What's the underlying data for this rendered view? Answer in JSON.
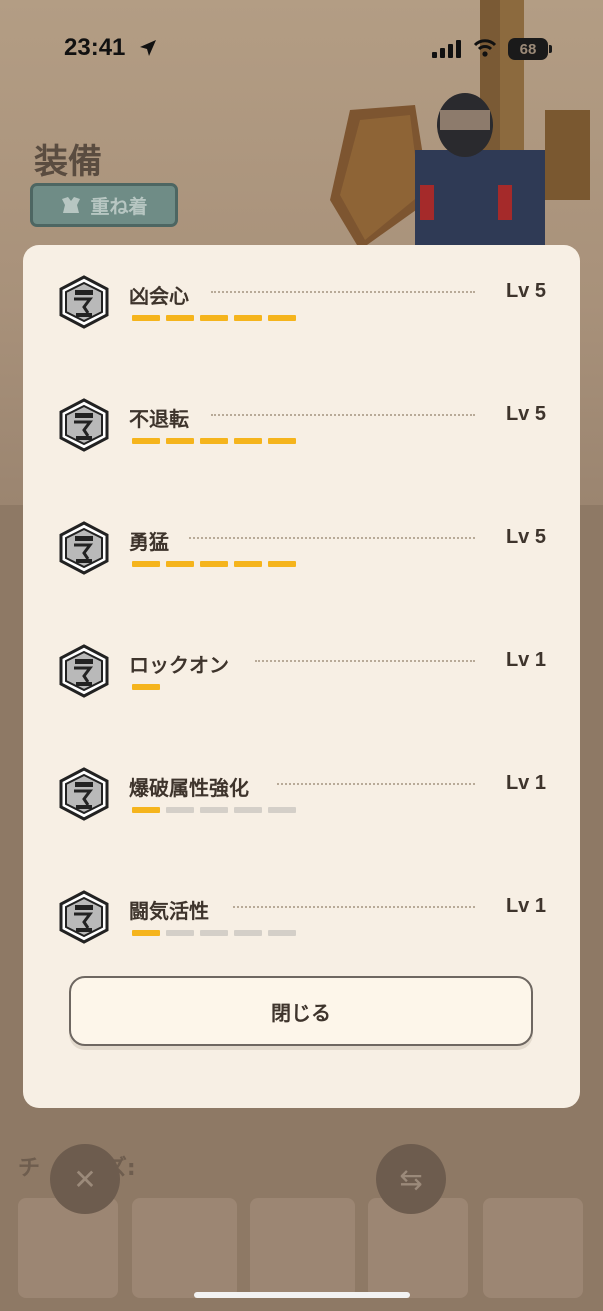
{
  "status_bar": {
    "time": "23:41",
    "battery": "68"
  },
  "background": {
    "page_title": "装備",
    "layer_button_label": "重ね着",
    "section_label": "チ　リーズ:"
  },
  "modal": {
    "skills": [
      {
        "name": "凶会心",
        "level_label": "Lv 5",
        "level": 5,
        "max_level": 5
      },
      {
        "name": "不退転",
        "level_label": "Lv 5",
        "level": 5,
        "max_level": 5
      },
      {
        "name": "勇猛",
        "level_label": "Lv 5",
        "level": 5,
        "max_level": 5
      },
      {
        "name": "ロックオン",
        "level_label": "Lv 1",
        "level": 1,
        "max_level": 1
      },
      {
        "name": "爆破属性強化",
        "level_label": "Lv 1",
        "level": 1,
        "max_level": 5
      },
      {
        "name": "闘気活性",
        "level_label": "Lv 1",
        "level": 1,
        "max_level": 5
      }
    ],
    "close_label": "閉じる"
  },
  "colors": {
    "level_on": "#f5b41c",
    "level_off": "#d4cfc8",
    "modal_bg": "#f7efe4",
    "text": "#3e342c"
  },
  "icons": {
    "skill": "skill-hexagon-icon",
    "layer": "armor-layer-icon",
    "location": "location-arrow-icon",
    "signal": "cellular-signal-icon",
    "wifi": "wifi-icon"
  }
}
